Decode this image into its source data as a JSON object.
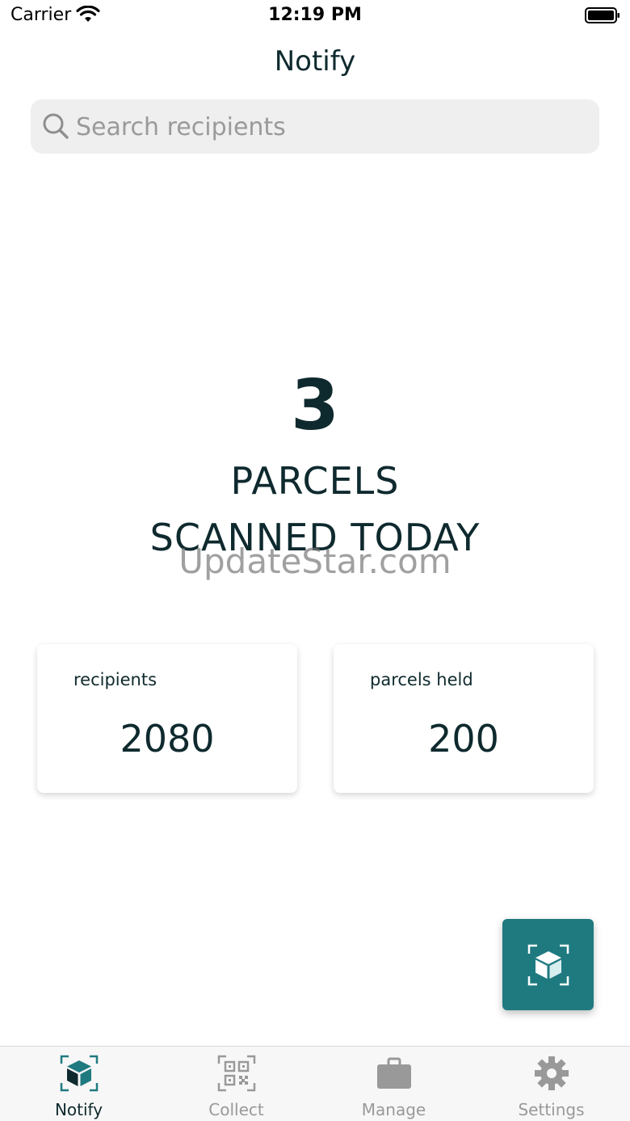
{
  "status_bar": {
    "carrier": "Carrier",
    "time": "12:19 PM"
  },
  "nav": {
    "title": "Notify"
  },
  "search": {
    "placeholder": "Search recipients",
    "value": ""
  },
  "hero": {
    "count": "3",
    "line1": "PARCELS",
    "line2": "SCANNED TODAY"
  },
  "watermark": "UpdateStar.com",
  "stats": [
    {
      "label": "recipients",
      "value": "2080"
    },
    {
      "label": "parcels held",
      "value": "200"
    }
  ],
  "fab": {
    "icon": "scan-parcel-icon"
  },
  "tabs": [
    {
      "label": "Notify",
      "icon": "parcel-scan-icon",
      "active": true
    },
    {
      "label": "Collect",
      "icon": "qr-code-icon",
      "active": false
    },
    {
      "label": "Manage",
      "icon": "briefcase-icon",
      "active": false
    },
    {
      "label": "Settings",
      "icon": "gear-icon",
      "active": false
    }
  ],
  "colors": {
    "accent": "#1f7a80",
    "text_dark": "#0f2a2e",
    "tab_inactive": "#999999",
    "search_bg": "#efefef"
  }
}
